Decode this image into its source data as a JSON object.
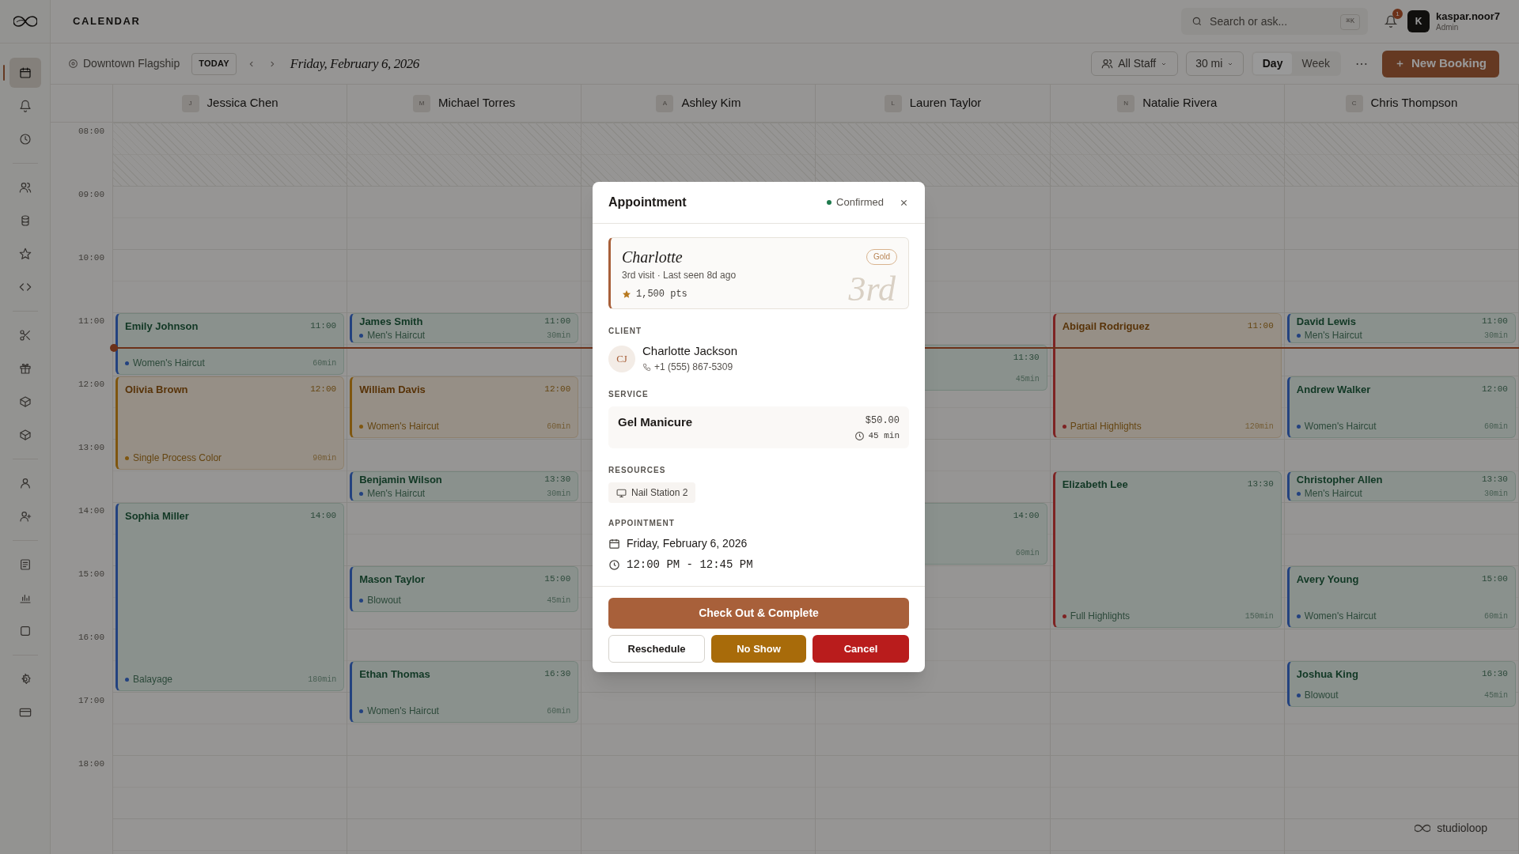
{
  "app": {
    "title": "CALENDAR"
  },
  "search": {
    "placeholder": "Search or ask...",
    "shortcut": "⌘K"
  },
  "notifications": {
    "count": "1"
  },
  "user": {
    "initial": "K",
    "name": "kaspar.noor7",
    "role": "Admin"
  },
  "sidebar": {
    "groups": [
      [
        {
          "kind": "calendar",
          "selected": true
        },
        {
          "kind": "bell",
          "selected": false
        },
        {
          "kind": "clock",
          "selected": false
        }
      ],
      [
        {
          "kind": "users",
          "selected": false
        },
        {
          "kind": "database",
          "selected": false
        },
        {
          "kind": "star",
          "selected": false
        },
        {
          "kind": "code",
          "selected": false
        }
      ],
      [
        {
          "kind": "scissors",
          "selected": false
        },
        {
          "kind": "gift",
          "selected": false
        },
        {
          "kind": "box",
          "selected": false
        },
        {
          "kind": "box",
          "selected": false
        }
      ],
      [
        {
          "kind": "user",
          "selected": false
        },
        {
          "kind": "userplus",
          "selected": false
        }
      ],
      [
        {
          "kind": "file",
          "selected": false
        },
        {
          "kind": "chart",
          "selected": false
        },
        {
          "kind": "square",
          "selected": false
        }
      ],
      [
        {
          "kind": "settings",
          "selected": false
        },
        {
          "kind": "card",
          "selected": false
        }
      ]
    ]
  },
  "toolbar": {
    "location": "Downtown Flagship",
    "today": "TODAY",
    "date": "Friday, February 6, 2026",
    "staff_filter": "All Staff",
    "interval": "30 mi",
    "views": [
      {
        "label": "Day",
        "selected": true
      },
      {
        "label": "Week",
        "selected": false
      }
    ],
    "more": "⋯",
    "new_booking": "New Booking"
  },
  "calendar": {
    "hours": [
      "08:00",
      "09:00",
      "10:00",
      "11:00",
      "12:00",
      "13:00",
      "14:00",
      "15:00",
      "16:00",
      "17:00",
      "18:00"
    ],
    "staff": [
      {
        "initial": "J",
        "name": "Jessica Chen",
        "appointments": [
          {
            "kind": "confirmed",
            "client": "Emily Johnson",
            "time": "11:00",
            "service": "Women's Haircut",
            "duration": "60min"
          },
          {
            "kind": "pending",
            "client": "Olivia Brown",
            "time": "12:00",
            "service": "Single Process Color",
            "duration": "90min"
          },
          {
            "kind": "confirmed",
            "client": "Sophia Miller",
            "time": "14:00",
            "service": "Balayage",
            "duration": "180min"
          }
        ]
      },
      {
        "initial": "M",
        "name": "Michael Torres",
        "appointments": [
          {
            "kind": "confirmed",
            "client": "James Smith",
            "time": "11:00",
            "service": "Men's Haircut",
            "duration": "30min"
          },
          {
            "kind": "pending",
            "client": "William Davis",
            "time": "12:00",
            "service": "Women's Haircut",
            "duration": "60min"
          },
          {
            "kind": "confirmed",
            "client": "Benjamin Wilson",
            "time": "13:30",
            "service": "Men's Haircut",
            "duration": "30min"
          },
          {
            "kind": "confirmed",
            "client": "Mason Taylor",
            "time": "15:00",
            "service": "Blowout",
            "duration": "45min"
          },
          {
            "kind": "confirmed",
            "client": "Ethan Thomas",
            "time": "16:30",
            "service": "Women's Haircut",
            "duration": "60min"
          }
        ]
      },
      {
        "initial": "A",
        "name": "Ashley Kim"
      },
      {
        "initial": "L",
        "name": "Lauren Taylor",
        "appointments": [
          {
            "kind": "confirmed",
            "time": "11:30",
            "duration": "45min"
          },
          {
            "kind": "confirmed",
            "time": "14:00",
            "duration": "60min"
          }
        ]
      },
      {
        "initial": "N",
        "name": "Natalie Rivera",
        "appointments": [
          {
            "kind": "hold",
            "client": "Abigail Rodriguez",
            "time": "11:00",
            "service": "Partial Highlights",
            "duration": "120min"
          },
          {
            "kind": "priority",
            "client": "Elizabeth Lee",
            "time": "13:30",
            "service": "Full Highlights",
            "duration": "150min"
          }
        ]
      },
      {
        "initial": "C",
        "name": "Chris Thompson",
        "appointments": [
          {
            "kind": "confirmed",
            "client": "David Lewis",
            "time": "11:00",
            "service": "Men's Haircut",
            "duration": "30min"
          },
          {
            "kind": "confirmed",
            "client": "Andrew Walker",
            "time": "12:00",
            "service": "Women's Haircut",
            "duration": "60min"
          },
          {
            "kind": "confirmed",
            "client": "Christopher Allen",
            "time": "13:30",
            "service": "Men's Haircut",
            "duration": "30min"
          },
          {
            "kind": "confirmed",
            "client": "Avery Young",
            "time": "15:00",
            "service": "Women's Haircut",
            "duration": "60min"
          },
          {
            "kind": "confirmed",
            "client": "Joshua King",
            "time": "16:30",
            "service": "Blowout",
            "duration": "45min"
          }
        ]
      }
    ]
  },
  "brand": {
    "name": "studioloop"
  },
  "dialog": {
    "title": "Appointment",
    "status": "Confirmed",
    "loyalty": {
      "first_name": "Charlotte",
      "summary": "3rd visit · Last seen 8d ago",
      "points": "1,500 pts",
      "tier": "Gold",
      "watermark": "3rd"
    },
    "client": {
      "label": "CLIENT",
      "initials": "CJ",
      "name": "Charlotte Jackson",
      "phone": "+1 (555) 867-5309"
    },
    "service": {
      "label": "SERVICE",
      "name": "Gel Manicure",
      "price": "$50.00",
      "duration": "45 min"
    },
    "resources": {
      "label": "RESOURCES",
      "items": [
        "Nail Station 2"
      ]
    },
    "appointment": {
      "label": "APPOINTMENT",
      "date": "Friday, February 6, 2026",
      "time": "12:00 PM - 12:45 PM"
    },
    "actions": {
      "primary": "Check Out & Complete",
      "reschedule": "Reschedule",
      "no_show": "No Show",
      "cancel": "Cancel"
    }
  }
}
